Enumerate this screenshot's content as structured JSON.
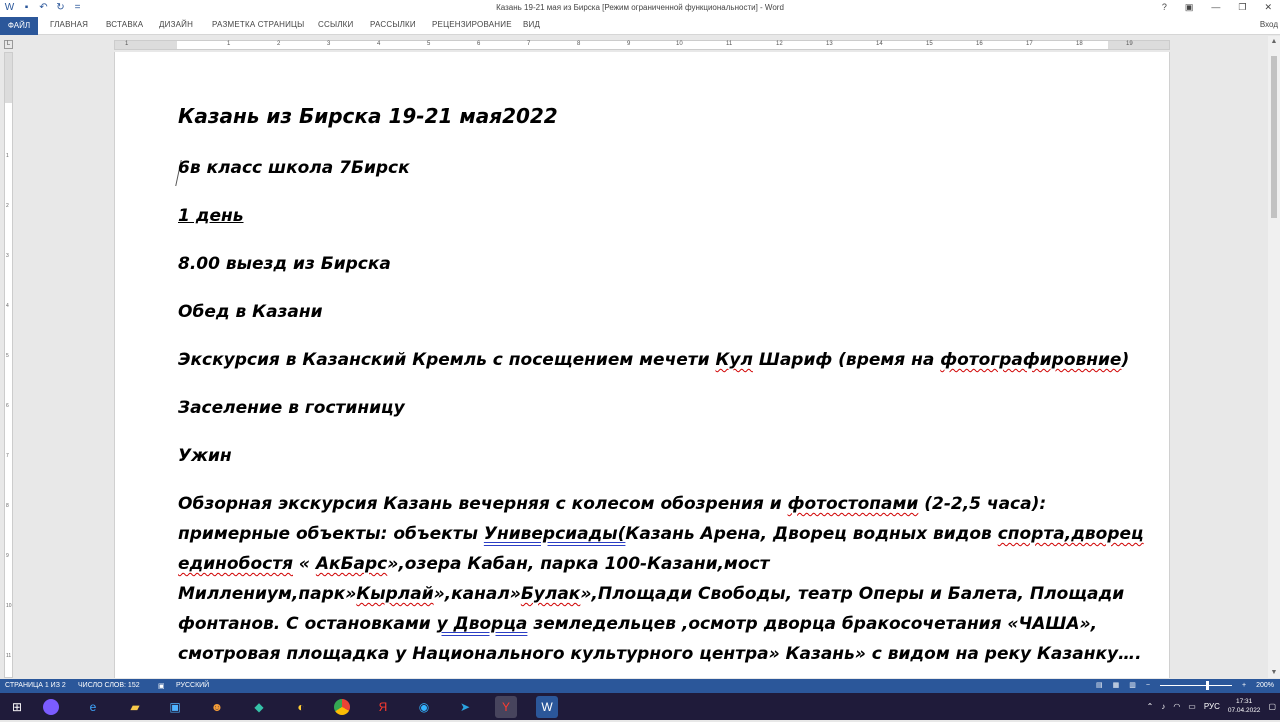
{
  "window": {
    "title": "Казань 19-21 мая из Бирска [Режим ограниченной функциональности] - Word",
    "controls": [
      "?",
      "▣",
      "—",
      "❐",
      "✕"
    ],
    "sign_in": "Вход"
  },
  "quick_access": [
    "word-logo-icon",
    "save-icon",
    "undo-icon",
    "redo-icon",
    "customize-icon"
  ],
  "ribbon": {
    "file_tab": "ФАЙЛ",
    "tabs": [
      "ГЛАВНАЯ",
      "ВСТАВКА",
      "ДИЗАЙН",
      "РАЗМЕТКА СТРАНИЦЫ",
      "ССЫЛКИ",
      "РАССЫЛКИ",
      "РЕЦЕНЗИРОВАНИЕ",
      "ВИД"
    ]
  },
  "ruler": {
    "corner": "L",
    "numbers": [
      "1",
      "1",
      "2",
      "3",
      "4",
      "5",
      "6",
      "7",
      "8",
      "9",
      "10",
      "11",
      "12",
      "13",
      "14",
      "15",
      "16",
      "17",
      "18",
      "19"
    ],
    "vnumbers": [
      "1",
      "2",
      "3",
      "4",
      "5",
      "6",
      "7",
      "8",
      "9",
      "10",
      "11"
    ]
  },
  "document": {
    "heading": "Казань из Бирска 19-21 мая2022",
    "class_line": " 6в класс школа 7Бирск",
    "day1": "1 день",
    "departure": "8.00 выезд из Бирска",
    "lunch": "Обед в Казани",
    "excursion": {
      "a": "Экскурсия в Казанский Кремль  с посещением мечети ",
      "b": "Кул",
      "c": " Шариф (время на ",
      "d": "фотографировние",
      "e": ")"
    },
    "checkin": "Заселение в гостиницу",
    "dinner": "Ужин",
    "tour": {
      "l1a": "Обзорная экскурсия Казань вечерняя с колесом обозрения и ",
      "l1b": "фотостопами",
      "l1c": " (2-2,5 часа):",
      "l2a": "примерные объекты: объекты ",
      "l2b": "Универсиады(",
      "l2c": "Казань Арена, Дворец водных видов ",
      "l2d": "спорта,дворец",
      "l3a": "единобостя",
      "l3b": " « ",
      "l3c": "АкБарс",
      "l3d": "»,озера Кабан, парка 100-Казани,мост",
      "l4a": "Миллениум,парк»",
      "l4b": "Кырлай",
      "l4c": "»,канал»",
      "l4d": "Булак",
      "l4e": "»,Площади Свободы, театр Оперы и Балета, Площади",
      "l5a": "фонтанов. С остановками ",
      "l5b": "у  Дворца",
      "l5c": " земледельцев ,осмотр дворца бракосочетания «ЧАША»,",
      "l6": "смотровая площадка у Национального культурного центра» Казань» с видом на реку Казанку…."
    }
  },
  "status": {
    "page": "СТРАНИЦА 1 ИЗ 2",
    "words": "ЧИСЛО СЛОВ: 152",
    "language": "РУССКИЙ",
    "zoom": "200%"
  },
  "taskbar": {
    "icons": [
      "windows-start-icon",
      "cortana-icon",
      "edge-legacy-icon",
      "file-explorer-icon",
      "app-icon",
      "game-icon",
      "photos-icon",
      "paint-icon",
      "chrome-icon",
      "yandex-icon",
      "edge-icon",
      "telegram-icon",
      "yandex-browser-icon",
      "word-icon"
    ],
    "language": "РУС",
    "time": "17:31",
    "date": "07.04.2022"
  }
}
